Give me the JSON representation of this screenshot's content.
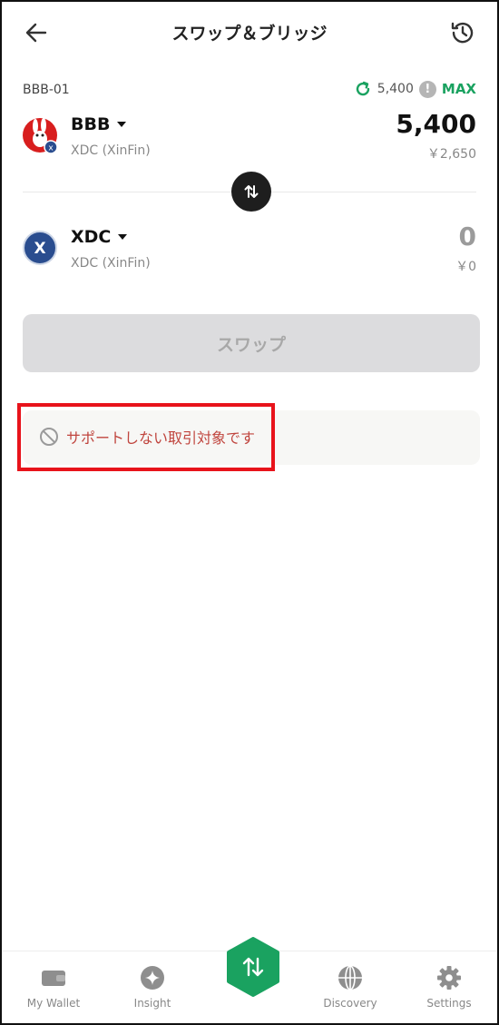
{
  "header": {
    "title": "スワップ＆ブリッジ",
    "back_icon": "back-arrow-icon",
    "history_icon": "history-icon"
  },
  "from": {
    "pair_label": "BBB-01",
    "balance": "5,400",
    "max_label": "MAX",
    "token": "BBB",
    "network": "XDC (XinFin)",
    "amount": "5,400",
    "fiat": "￥2,650"
  },
  "to": {
    "token": "XDC",
    "token_letter": "X",
    "network": "XDC (XinFin)",
    "amount": "0",
    "fiat": "￥0"
  },
  "swap_button_label": "スワップ",
  "notice": {
    "text": "サポートしない取引対象です"
  },
  "nav": {
    "items": [
      {
        "label": "My Wallet",
        "icon": "wallet-icon"
      },
      {
        "label": "Insight",
        "icon": "sparkle-icon"
      },
      {
        "label": "Discovery",
        "icon": "globe-icon"
      },
      {
        "label": "Settings",
        "icon": "gear-icon"
      }
    ]
  },
  "colors": {
    "accent_green": "#1aa260",
    "error_red": "#c0453e",
    "highlight_red": "#e8131b",
    "disabled_button": "#dcdcde"
  }
}
